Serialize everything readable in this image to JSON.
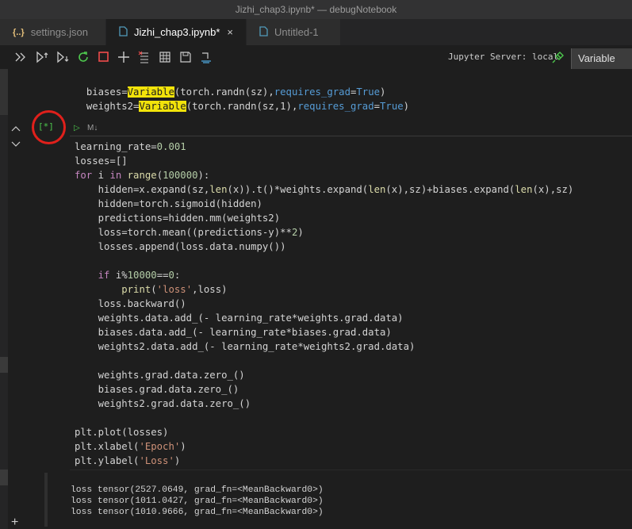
{
  "window": {
    "title": "Jizhi_chap3.ipynb* — debugNotebook"
  },
  "tabs": [
    {
      "icon": "{..}",
      "label": "settings.json"
    },
    {
      "icon": "file",
      "label": "Jizhi_chap3.ipynb*",
      "close": "×"
    },
    {
      "icon": "file",
      "label": "Untitled-1"
    }
  ],
  "toolbar": {
    "server_label": "Jupyter Server: local",
    "variable_button": "Variable",
    "icons": [
      "run-all-icon",
      "run-above-icon",
      "run-below-icon",
      "restart-kernel-icon",
      "interrupt-icon",
      "add-cell-icon",
      "clear-outputs-icon",
      "variable-explorer-icon",
      "save-icon",
      "export-icon",
      "plug-icon"
    ]
  },
  "colors": {
    "keyword": "#c586c0",
    "builtin": "#dcdcaa",
    "constant": "#569cd6",
    "number": "#b5cea8",
    "string": "#ce9178",
    "highlight": "#f2e30a",
    "exec_marker": "#4ec94e",
    "annotation_circle": "#e0201b"
  },
  "prev_cell": {
    "line1": {
      "a": "biases=",
      "hl": "Variable",
      "b": "(torch.randn(sz),",
      "c": "requires_grad",
      "d": "=",
      "e": "True",
      "f": ")"
    },
    "line2": {
      "a": "weights2=",
      "hl": "Variable",
      "b": "(torch.randn(sz,1),",
      "c": "requires_grad",
      "d": "=",
      "e": "True",
      "f": ")"
    }
  },
  "cell": {
    "exec_count": "[*]",
    "run_button": "▷",
    "markdown_toggle": "M↓",
    "code": {
      "l1a": "learning_rate=",
      "l1b": "0.001",
      "l2": "losses=[]",
      "l3a": "for",
      "l3b": " i ",
      "l3c": "in",
      "l3d": " ",
      "l3e": "range",
      "l3f": "(",
      "l3g": "100000",
      "l3h": "):",
      "l4a": "    hidden=x.expand(sz,",
      "l4b": "len",
      "l4c": "(x)).t()*weights.expand(",
      "l4d": "len",
      "l4e": "(x),sz)+biases.expand(",
      "l4f": "len",
      "l4g": "(x),sz)",
      "l5": "    hidden=torch.sigmoid(hidden)",
      "l6": "    predictions=hidden.mm(weights2)",
      "l7a": "    loss=torch.mean((predictions-y)**",
      "l7b": "2",
      "l7c": ")",
      "l8": "    losses.append(loss.data.numpy())",
      "l10a": "    ",
      "l10b": "if",
      "l10c": " i%",
      "l10d": "10000",
      "l10e": "==",
      "l10f": "0",
      "l10g": ":",
      "l11a": "        ",
      "l11b": "print",
      "l11c": "(",
      "l11d": "'loss'",
      "l11e": ",loss)",
      "l12": "    loss.backward()",
      "l13": "    weights.data.add_(- learning_rate*weights.grad.data)",
      "l14": "    biases.data.add_(- learning_rate*biases.grad.data)",
      "l15": "    weights2.data.add_(- learning_rate*weights2.grad.data)",
      "l17": "    weights.grad.data.zero_()",
      "l18": "    biases.grad.data.zero_()",
      "l19": "    weights2.grad.data.zero_()",
      "l21": "plt.plot(losses)",
      "l22a": "plt.xlabel(",
      "l22b": "'Epoch'",
      "l22c": ")",
      "l23a": "plt.ylabel(",
      "l23b": "'Loss'",
      "l23c": ")"
    },
    "output": [
      "loss tensor(2527.0649, grad_fn=<MeanBackward0>)",
      "loss tensor(1011.0427, grad_fn=<MeanBackward0>)",
      "loss tensor(1010.9666, grad_fn=<MeanBackward0>)"
    ]
  },
  "gutter": {
    "collapse_up": "^",
    "collapse_down": "v",
    "add_cell": "+"
  }
}
